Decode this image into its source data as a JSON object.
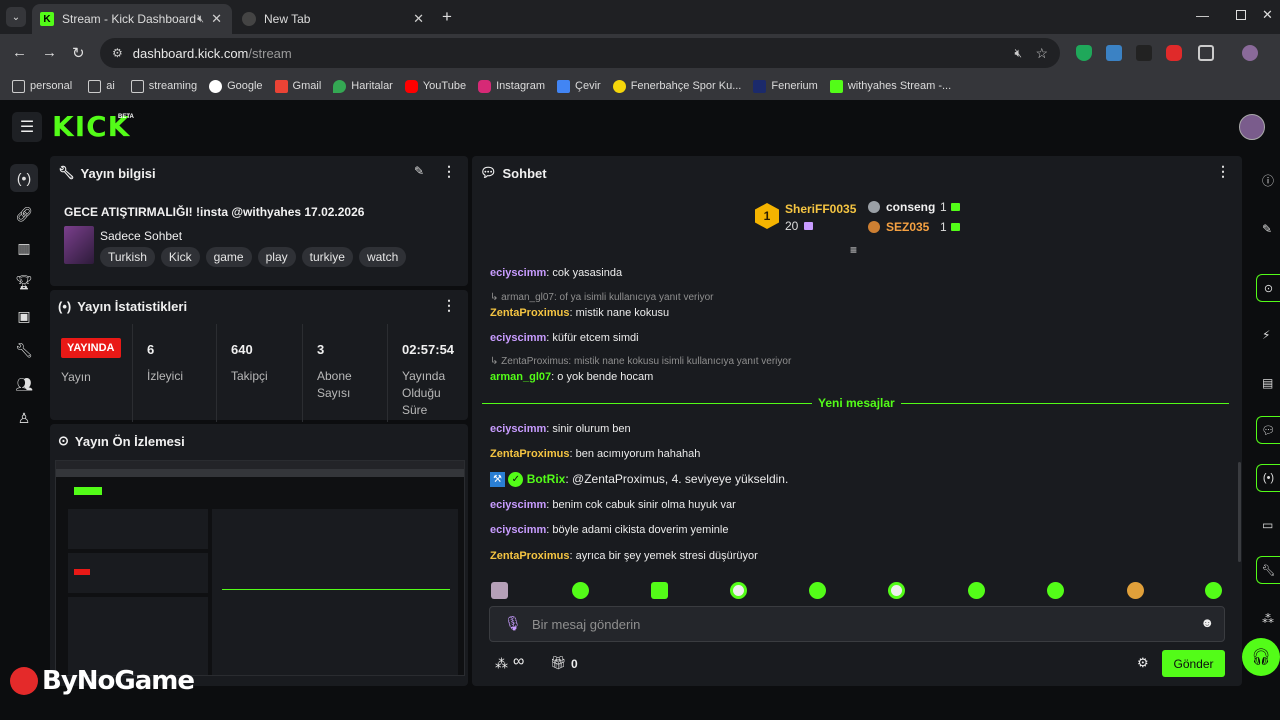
{
  "browser": {
    "tabs": [
      {
        "title": "Stream - Kick Dashboard",
        "favicon": "K"
      },
      {
        "title": "New Tab"
      }
    ],
    "url": {
      "domain": "dashboard.kick.com",
      "path": "/stream"
    },
    "bookmarks": [
      "personal",
      "ai",
      "streaming",
      "Google",
      "Gmail",
      "Haritalar",
      "YouTube",
      "Instagram",
      "Çevir",
      "Fenerbahçe Spor Ku...",
      "Fenerium",
      "withyahes Stream -..."
    ]
  },
  "app": {
    "logo": "KICK",
    "logo_badge": "BETA",
    "accent": "#53fc18"
  },
  "stream_info": {
    "title": "Yayın bilgisi",
    "stream_title": "GECE ATIŞTIRMALIĞI! !insta @withyahes 17.02.2026",
    "category": "Sadece Sohbet",
    "tags": [
      "Turkish",
      "Kick",
      "game",
      "play",
      "turkiye",
      "watch"
    ]
  },
  "stats": {
    "title": "Yayın İstatistikleri",
    "live_badge": "YAYINDA",
    "status_label": "Yayın",
    "viewers": {
      "value": "6",
      "label": "İzleyici"
    },
    "followers": {
      "value": "640",
      "label": "Takipçi"
    },
    "subs": {
      "value": "3",
      "label": "Abone Sayısı"
    },
    "uptime": {
      "value": "02:57:54",
      "label": "Yayında Olduğu Süre"
    }
  },
  "preview": {
    "title": "Yayın Ön İzlemesi"
  },
  "chat": {
    "title": "Sohbet",
    "leaderboard": {
      "first": {
        "rank": "1",
        "name": "SheriFF0035",
        "count": "20"
      },
      "second": {
        "name": "conseng",
        "count": "1"
      },
      "third": {
        "name": "SEZ035",
        "count": "1"
      }
    },
    "new_messages_label": "Yeni mesajlar",
    "messages_before": [
      {
        "user": "eciyscimm",
        "text": "cok yasasinda",
        "color": "#c89cff"
      },
      {
        "reply": "arman_gl07: of ya isimli kullanıcıya yanıt veriyor",
        "user": "ZentaProximus",
        "text": "mistik nane kokusu",
        "color": "#f5c542"
      },
      {
        "user": "eciyscimm",
        "text": "küfür etcem simdi",
        "color": "#c89cff"
      },
      {
        "reply": "ZentaProximus: mistik nane kokusu isimli kullanıcıya yanıt veriyor",
        "user": "arman_gl07",
        "text": "o yok bende hocam",
        "color": "#53fc18"
      }
    ],
    "messages_after": [
      {
        "user": "eciyscimm",
        "text": "sinir olurum ben",
        "color": "#c89cff"
      },
      {
        "user": "ZentaProximus",
        "text": "ben acımıyorum hahahah",
        "color": "#f5c542"
      },
      {
        "user": "BotRix",
        "text": "@ZentaProximus, 4. seviyeye yükseldin.",
        "color": "#53fc18"
      },
      {
        "user": "eciyscimm",
        "text": "benim cok cabuk sinir olma huyuk var",
        "color": "#c89cff"
      },
      {
        "user": "eciyscimm",
        "text": "böyle adami cikista doverim yeminle",
        "color": "#c89cff"
      },
      {
        "user": "ZentaProximus",
        "text": "ayrıca bir şey yemek stresi düşürüyor",
        "color": "#f5c542"
      }
    ],
    "input_placeholder": "Bir mesaj gönderin",
    "points": "∞",
    "gift_count": "0",
    "send_label": "Gönder"
  },
  "watermark": "ByNoGame"
}
